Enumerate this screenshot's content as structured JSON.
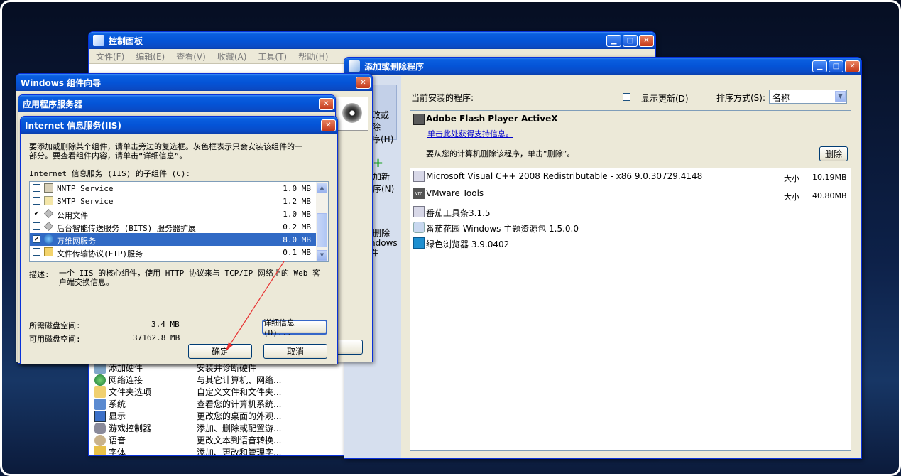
{
  "control_panel": {
    "title": "控制面板",
    "menu": [
      "文件(F)",
      "编辑(E)",
      "查看(V)",
      "收藏(A)",
      "工具(T)",
      "帮助(H)"
    ],
    "items": [
      {
        "name": "添加硬件",
        "desc": "安装并诊断硬件"
      },
      {
        "name": "网络连接",
        "desc": "与其它计算机、网络..."
      },
      {
        "name": "文件夹选项",
        "desc": "自定义文件和文件夹..."
      },
      {
        "name": "系统",
        "desc": "查看您的计算机系统..."
      },
      {
        "name": "显示",
        "desc": "更改您的桌面的外观..."
      },
      {
        "name": "游戏控制器",
        "desc": "添加、删除或配置游..."
      },
      {
        "name": "语音",
        "desc": "更改文本到语音转换..."
      },
      {
        "name": "字体",
        "desc": "添加、更改和管理字..."
      }
    ]
  },
  "arp": {
    "title": "添加或删除程序",
    "sidebar": {
      "change_remove": [
        "改或",
        "除",
        "序(H)"
      ],
      "add_new": [
        "加新",
        "序(N)"
      ],
      "add_remove_windows": [
        "/删除",
        "ndows",
        "件"
      ]
    },
    "current_label": "当前安装的程序:",
    "show_updates": "显示更新(D)",
    "sort_label": "排序方式(S):",
    "sort_value": "名称",
    "selected": {
      "name": "Adobe Flash Player ActiveX",
      "support_link": "单击此处获得支持信息。",
      "remove_hint": "要从您的计算机删除该程序，单击“删除”。",
      "remove_button": "删除"
    },
    "programs": [
      {
        "name": "Microsoft Visual C++ 2008 Redistributable - x86 9.0.30729.4148",
        "size_label": "大小",
        "size": "10.19MB"
      },
      {
        "name": "VMware Tools",
        "size_label": "大小",
        "size": "40.80MB"
      },
      {
        "name": "番茄工具条3.1.5",
        "size_label": "",
        "size": ""
      },
      {
        "name": "番茄花园 Windows 主题资源包 1.5.0.0",
        "size_label": "",
        "size": ""
      },
      {
        "name": "绿色浏览器 3.9.0402",
        "size_label": "",
        "size": ""
      }
    ]
  },
  "wizard": {
    "title": "Windows 组件向导",
    "next_fragment": "动"
  },
  "app_server": {
    "title": "应用程序服务器"
  },
  "iis": {
    "title": "Internet 信息服务(IIS)",
    "instructions": [
      "要添加或删除某个组件，请单击旁边的复选框。灰色框表示只会安装该组件的一",
      "部分。要查看组件内容，请单击“详细信息”。"
    ],
    "subcomponents_label": "Internet 信息服务 (IIS) 的子组件 (C):",
    "components": [
      {
        "name": "NNTP Service",
        "size": "1.0 MB",
        "checked": false,
        "selected": false,
        "icon": "news-icon"
      },
      {
        "name": "SMTP Service",
        "size": "1.2 MB",
        "checked": false,
        "selected": false,
        "icon": "mail-icon"
      },
      {
        "name": "公用文件",
        "size": "1.0 MB",
        "checked": true,
        "selected": false,
        "icon": "component-icon"
      },
      {
        "name": "后台智能传送服务 (BITS) 服务器扩展",
        "size": "0.2 MB",
        "checked": false,
        "selected": false,
        "icon": "component-icon"
      },
      {
        "name": "万维网服务",
        "size": "8.0 MB",
        "checked": true,
        "selected": true,
        "icon": "globe-icon"
      },
      {
        "name": "文件传输协议(FTP)服务",
        "size": "0.1 MB",
        "checked": false,
        "selected": false,
        "icon": "folder-icon"
      }
    ],
    "description_label": "描述:",
    "description": [
      "一个 IIS 的核心组件，使用 HTTP 协议来与 TCP/IP 网络上的 Web 客",
      "户端交换信息。"
    ],
    "disk_required_label": "所需磁盘空间:",
    "disk_required": "3.4 MB",
    "disk_available_label": "可用磁盘空间:",
    "disk_available": "37162.8 MB",
    "details_button": "详细信息 (D)...",
    "ok_button": "确定",
    "cancel_button": "取消"
  },
  "colors": {
    "titlebar": "#0454d7",
    "selection": "#316ac5",
    "window_bg": "#ece9d8",
    "link": "#0000cc",
    "annotation_arrow": "#e83030"
  }
}
